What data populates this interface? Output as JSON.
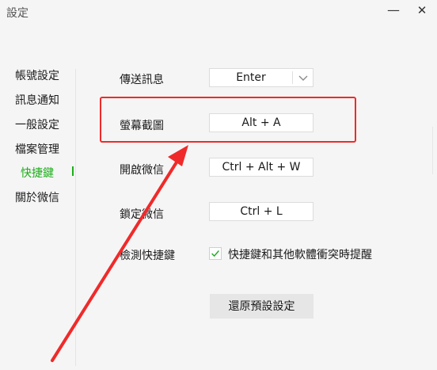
{
  "window": {
    "title": "設定",
    "minimize_symbol": "—",
    "close_symbol": "✕"
  },
  "sidebar": {
    "items": [
      {
        "label": "帳號設定",
        "active": false
      },
      {
        "label": "訊息通知",
        "active": false
      },
      {
        "label": "一般設定",
        "active": false
      },
      {
        "label": "檔案管理",
        "active": false
      },
      {
        "label": "快捷鍵",
        "active": true
      },
      {
        "label": "關於微信",
        "active": false
      }
    ]
  },
  "shortcuts": {
    "send": {
      "label": "傳送訊息",
      "value": "Enter"
    },
    "screenshot": {
      "label": "螢幕截圖",
      "value": "Alt + A"
    },
    "open": {
      "label": "開啟微信",
      "value": "Ctrl + Alt + W"
    },
    "lock": {
      "label": "鎖定微信",
      "value": "Ctrl + L"
    },
    "detect": {
      "label": "檢測快捷鍵",
      "checkbox_label": "快捷鍵和其他軟體衝突時提醒",
      "checked": true
    },
    "reset_label": "還原預設設定"
  },
  "colors": {
    "accent": "#1aad19",
    "annotation": "#f02a2a"
  }
}
